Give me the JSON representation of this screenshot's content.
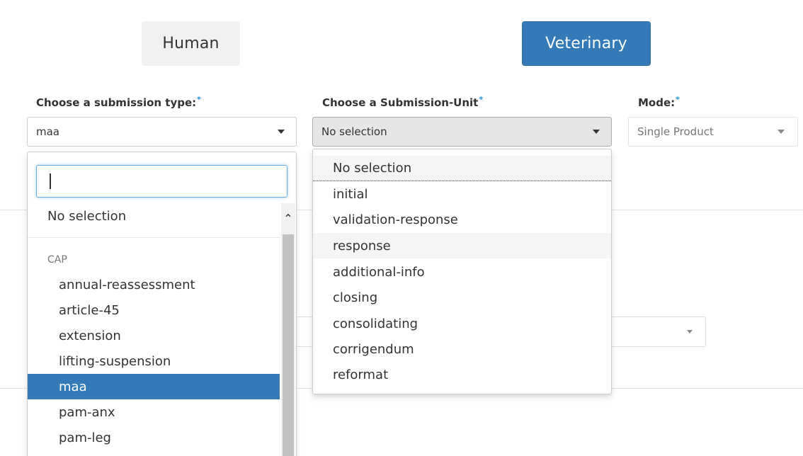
{
  "tabs": {
    "human": "Human",
    "veterinary": "Veterinary"
  },
  "labels": {
    "submission_type": "Choose a submission type:",
    "submission_unit": "Choose a Submission-Unit",
    "mode": "Mode:",
    "required_marker": "*"
  },
  "selects": {
    "submission_type_value": "maa",
    "submission_unit_value": "No selection",
    "mode_value": "Single Product"
  },
  "submission_type_dropdown": {
    "search_value": "",
    "no_selection": "No selection",
    "group": "CAP",
    "options": [
      "annual-reassessment",
      "article-45",
      "extension",
      "lifting-suspension",
      "maa",
      "pam-anx",
      "pam-leg"
    ],
    "selected": "maa"
  },
  "submission_unit_dropdown": {
    "options": [
      "No selection",
      "initial",
      "validation-response",
      "response",
      "additional-info",
      "closing",
      "consolidating",
      "corrigendum",
      "reformat"
    ],
    "highlighted": "response"
  },
  "colors": {
    "primary": "#337ab7",
    "required": "#1a8fd6",
    "focus": "#66afe9"
  }
}
